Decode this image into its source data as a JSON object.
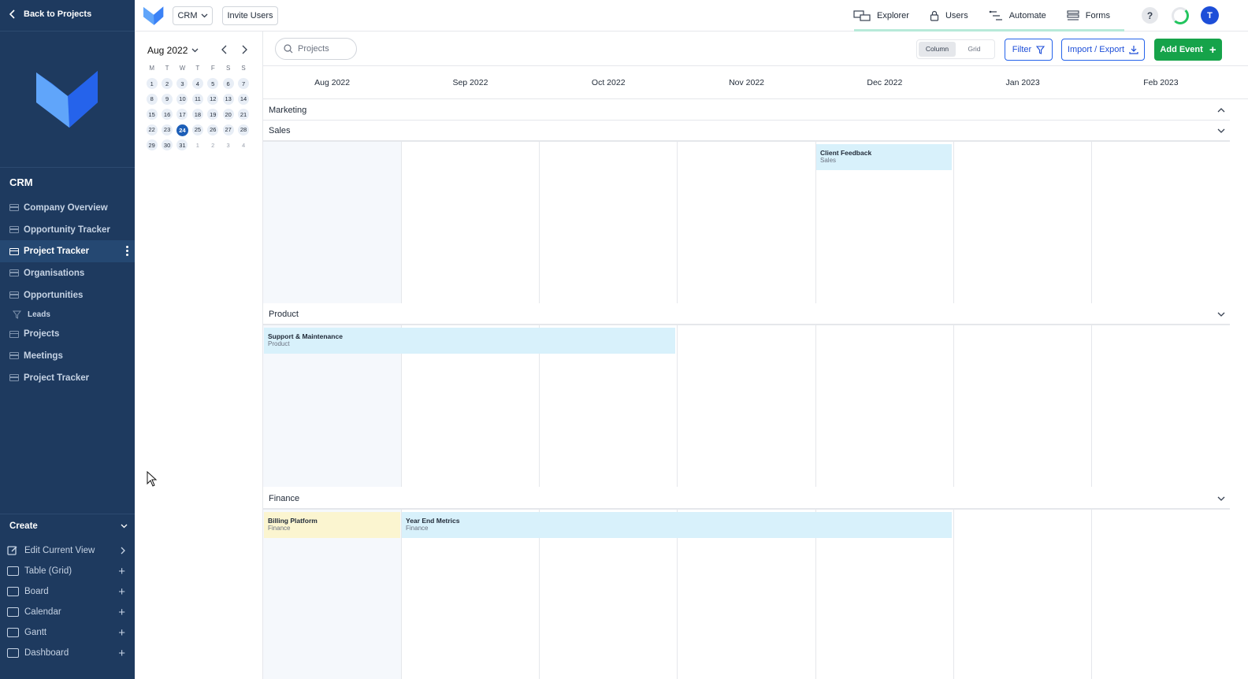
{
  "sidebar": {
    "back_label": "Back to Projects",
    "app_title": "CRM",
    "items": [
      {
        "label": "Company Overview",
        "active": false
      },
      {
        "label": "Opportunity Tracker",
        "active": false
      },
      {
        "label": "Project Tracker",
        "active": true
      },
      {
        "label": "Organisations",
        "active": false
      },
      {
        "label": "Opportunities",
        "active": false
      },
      {
        "label": "Leads",
        "sub": true
      },
      {
        "label": "Projects",
        "active": false
      },
      {
        "label": "Meetings",
        "active": false
      },
      {
        "label": "Project Tracker",
        "active": false
      }
    ],
    "create_label": "Create",
    "create_items": [
      {
        "label": "Edit Current View",
        "action": "chevron"
      },
      {
        "label": "Table (Grid)",
        "action": "plus"
      },
      {
        "label": "Board",
        "action": "plus"
      },
      {
        "label": "Calendar",
        "action": "plus"
      },
      {
        "label": "Gantt",
        "action": "plus"
      },
      {
        "label": "Dashboard",
        "action": "plus"
      }
    ]
  },
  "topbar": {
    "workspace": "CRM",
    "invite_label": "Invite Users",
    "nav": [
      "Explorer",
      "Users",
      "Automate",
      "Forms"
    ],
    "help": "?",
    "avatar_initial": "T"
  },
  "mini_calendar": {
    "month_label": "Aug 2022",
    "weekdays": [
      "M",
      "T",
      "W",
      "T",
      "F",
      "S",
      "S"
    ],
    "days": [
      "1",
      "2",
      "3",
      "4",
      "5",
      "6",
      "7",
      "8",
      "9",
      "10",
      "11",
      "12",
      "13",
      "14",
      "15",
      "16",
      "17",
      "18",
      "19",
      "20",
      "21",
      "22",
      "23",
      "24",
      "25",
      "26",
      "27",
      "28",
      "29",
      "30",
      "31",
      "1",
      "2",
      "3",
      "4"
    ],
    "today": "24"
  },
  "toolbar": {
    "search_placeholder": "Projects",
    "view_toggle": [
      "Column",
      "Grid"
    ],
    "filter_label": "Filter",
    "import_export_label": "Import / Export",
    "add_event_label": "Add Event"
  },
  "timeline": {
    "months": [
      "Aug 2022",
      "Sep 2022",
      "Oct 2022",
      "Nov 2022",
      "Dec 2022",
      "Jan 2023",
      "Feb 2023"
    ],
    "groups": [
      {
        "name": "Marketing",
        "expanded": true
      },
      {
        "name": "Sales",
        "expanded": false
      },
      {
        "name": "Product",
        "expanded": false
      },
      {
        "name": "Finance",
        "expanded": false
      }
    ],
    "events": [
      {
        "title": "Client Feedback",
        "group": "Sales",
        "color": "#d8f1fb"
      },
      {
        "title": "Support & Maintenance",
        "group": "Product",
        "color": "#d8f1fb"
      },
      {
        "title": "Billing Platform",
        "group": "Finance",
        "color": "#fbf5d0"
      },
      {
        "title": "Year End Metrics",
        "group": "Finance",
        "color": "#d8f1fb"
      }
    ]
  },
  "colors": {
    "sidebar": "#1e3a5f",
    "accent": "#1d4ed8",
    "add_button": "#16a34a"
  }
}
